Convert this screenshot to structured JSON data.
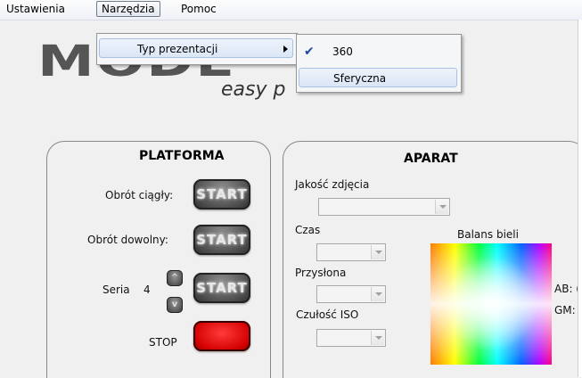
{
  "menubar": {
    "items": [
      "Ustawienia",
      "Narzędzia",
      "Pomoc"
    ]
  },
  "tools_menu": {
    "item": "Typ prezentacji"
  },
  "submenu": {
    "items": [
      "360",
      "Sferyczna"
    ],
    "checked": "360"
  },
  "logo": {
    "text": "MODE",
    "tagline": "easy p"
  },
  "platforma": {
    "title": "PLATFORMA",
    "rows": [
      {
        "label": "Obrót ciągły:",
        "button": "START"
      },
      {
        "label": "Obrót dowolny:",
        "button": "START"
      },
      {
        "label": "Seria",
        "value": "4",
        "button": "START"
      }
    ],
    "up_label": "^",
    "down_label": "v",
    "stop_label": "STOP"
  },
  "aparat": {
    "title": "APARAT",
    "fields": [
      {
        "label": "Jakość zdjęcia",
        "value": ""
      },
      {
        "label": "Czas",
        "value": ""
      },
      {
        "label": "Przysłona",
        "value": ""
      },
      {
        "label": "Czułość ISO",
        "value": ""
      }
    ],
    "balance_label": "Balans bieli",
    "ab_label": "AB: (",
    "gm_label": "GM: ("
  }
}
